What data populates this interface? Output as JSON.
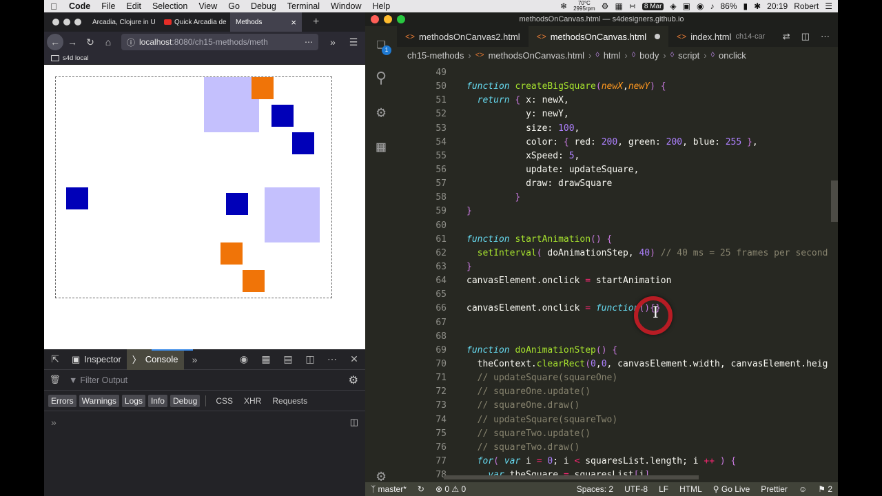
{
  "menubar": {
    "app": "Code",
    "items": [
      "File",
      "Edit",
      "Selection",
      "View",
      "Go",
      "Debug",
      "Terminal",
      "Window",
      "Help"
    ],
    "temp": "70°C",
    "rpm": "2995rpm",
    "date": "8 Mar",
    "battery": "86%",
    "time": "20:19",
    "user": "Robert"
  },
  "firefox": {
    "tabs": [
      {
        "title": "Arcadia, Clojure in U"
      },
      {
        "title": "Quick Arcadia de"
      },
      {
        "title": "Methods"
      }
    ],
    "url_host": "localhost",
    "url_path": ":8080/ch15-methods/meth",
    "bookmark": "s4d local",
    "canvas_squares": [
      {
        "color": "#c4c0fd",
        "label": "big-square"
      },
      {
        "color": "#f07408",
        "label": "small-square"
      },
      {
        "color": "#0000b8",
        "label": "small-square"
      }
    ]
  },
  "devtools": {
    "tabs": [
      "Inspector",
      "Console"
    ],
    "filter_placeholder": "Filter Output",
    "levels": [
      "Errors",
      "Warnings",
      "Logs",
      "Info",
      "Debug"
    ],
    "types": [
      "CSS",
      "XHR",
      "Requests"
    ],
    "prompt": "»"
  },
  "vscode": {
    "title": "methodsOnCanvas.html — s4designers.github.io",
    "tabs": [
      {
        "name": "methodsOnCanvas2.html",
        "sub": ""
      },
      {
        "name": "methodsOnCanvas.html",
        "sub": ""
      },
      {
        "name": "index.html",
        "sub": "ch14-car"
      }
    ],
    "breadcrumb": [
      "ch15-methods",
      "methodsOnCanvas.html",
      "html",
      "body",
      "script",
      "onclick"
    ],
    "line_numbers": [
      "49",
      "50",
      "51",
      "52",
      "53",
      "54",
      "55",
      "56",
      "57",
      "58",
      "59",
      "60",
      "61",
      "62",
      "63",
      "64",
      "65",
      "66",
      "67",
      "68",
      "69",
      "70",
      "71",
      "72",
      "73",
      "74",
      "75",
      "76",
      "77",
      "78"
    ],
    "source_lines": [
      "",
      "function createBigSquare(newX,newY) {",
      "  return { x: newX,",
      "           y: newY,",
      "           size: 100,",
      "           color: { red: 200, green: 200, blue: 255 },",
      "           xSpeed: 5,",
      "           update: updateSquare,",
      "           draw: drawSquare",
      "         }",
      "}",
      "",
      "function startAnimation() {",
      "  setInterval( doAnimationStep, 40) // 40 ms = 25 frames per second",
      "}",
      "canvasElement.onclick = startAnimation",
      "",
      "canvasElement.onclick = function(){}",
      "",
      "",
      "function doAnimationStep() {",
      "  theContext.clearRect(0,0, canvasElement.width, canvasElement.heig",
      "  // updateSquare(squareOne)",
      "  // squareOne.update()",
      "  // squareOne.draw()",
      "  // updateSquare(squareTwo)",
      "  // squareTwo.update()",
      "  // squareTwo.draw()",
      "  for( var i = 0; i < squaresList.length; i ++ ) {",
      "    var theSquare = squaresList[i]"
    ],
    "activity_badge": "1",
    "status": {
      "branch": "master*",
      "problems": "⊗ 0 ⚠ 0",
      "spaces": "Spaces: 2",
      "encoding": "UTF-8",
      "eol": "LF",
      "lang": "HTML",
      "golive": "Go Live",
      "prettier": "Prettier",
      "notif": "2"
    }
  }
}
